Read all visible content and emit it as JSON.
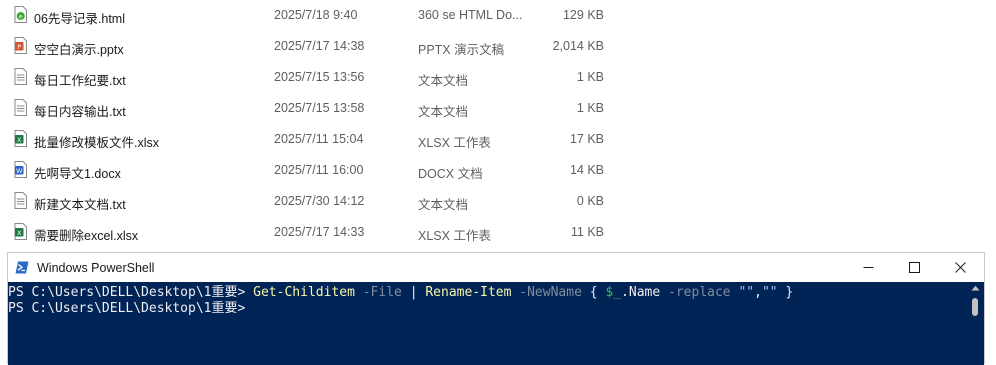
{
  "files": [
    {
      "name": "06先导记录.html",
      "date": "2025/7/18 9:40",
      "type": "360 se HTML Do...",
      "size": "129 KB",
      "icon": "html-file-icon"
    },
    {
      "name": "空空白演示.pptx",
      "date": "2025/7/17 14:38",
      "type": "PPTX 演示文稿",
      "size": "2,014 KB",
      "icon": "pptx-file-icon"
    },
    {
      "name": "每日工作纪要.txt",
      "date": "2025/7/15 13:56",
      "type": "文本文档",
      "size": "1 KB",
      "icon": "txt-file-icon"
    },
    {
      "name": "每日内容输出.txt",
      "date": "2025/7/15 13:58",
      "type": "文本文档",
      "size": "1 KB",
      "icon": "txt-file-icon"
    },
    {
      "name": "批量修改模板文件.xlsx",
      "date": "2025/7/11 15:04",
      "type": "XLSX 工作表",
      "size": "17 KB",
      "icon": "xlsx-file-icon"
    },
    {
      "name": "先啊导文1.docx",
      "date": "2025/7/11 16:00",
      "type": "DOCX 文档",
      "size": "14 KB",
      "icon": "docx-file-icon"
    },
    {
      "name": "新建文本文档.txt",
      "date": "2025/7/30 14:12",
      "type": "文本文档",
      "size": "0 KB",
      "icon": "txt-file-icon"
    },
    {
      "name": "需要删除excel.xlsx",
      "date": "2025/7/17 14:33",
      "type": "XLSX 工作表",
      "size": "11 KB",
      "icon": "xlsx-file-icon"
    }
  ],
  "powershell": {
    "title": "Windows PowerShell",
    "line1": {
      "prompt": "PS C:\\Users\\DELL\\Desktop\\1重要> ",
      "cmd1": "Get-Childitem",
      "param1": " -File ",
      "pipe": "| ",
      "cmd2": "Rename-Item",
      "param2": " -NewName ",
      "brace_open": "{ ",
      "var": "$_",
      "member": ".Name ",
      "param3": "-replace ",
      "str1": "\"\"",
      "comma": ",",
      "str2": "\"\"",
      "brace_close": " }"
    },
    "line2": {
      "prompt": "PS C:\\Users\\DELL\\Desktop\\1重要>"
    }
  },
  "colors": {
    "console_bg": "#012456",
    "console_text": "#eeedf0",
    "cmdlet": "#f7f7a7",
    "parameter": "#7f8c9e",
    "variable": "#3fb950"
  }
}
